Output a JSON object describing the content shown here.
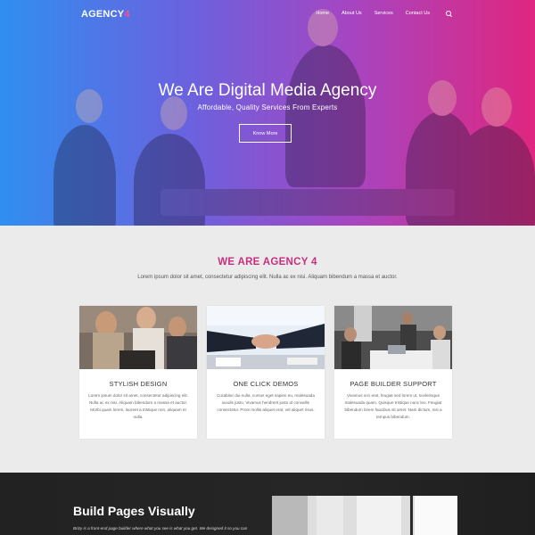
{
  "logo": {
    "text": "AGENCY",
    "accent": "4"
  },
  "nav": {
    "items": [
      "Home",
      "About Us",
      "Services",
      "Contact Us"
    ]
  },
  "hero": {
    "title": "We Are Digital Media Agency",
    "subtitle": "Affordable, Quality Services From Experts",
    "button_label": "Know More"
  },
  "about": {
    "title": "WE ARE AGENCY 4",
    "description": "Lorem ipsum dolor sit amet, consectetur adipiscing elit. Nulla ac ex nisi. Aliquam bibendum a massa et auctor."
  },
  "cards": [
    {
      "title": "STYLISH DESIGN",
      "text": "Lorem ipsum dolor sit amet, consectetur adipiscing elit. Nulla ac ex nisi. Aliquam bibendum a massa et auctor. Morbi quam lorem, laoreet a tristique non, aliquam et nulla."
    },
    {
      "title": "ONE CLICK DEMOS",
      "text": "Curabitur dui nulla, cursus eget sapien eu, malesuada iaculis justo. Vivamus hendrerit justo id convallis consectetur. Proin mollis aliquet erat, vel aliquet risus."
    },
    {
      "title": "PAGE BUILDER SUPPORT",
      "text": "Vivamus orci erat, feugiat sed lorem ut, scelerisque malesuada quam. Quisque tristique nunc leo. Feugiat bibendum lorem faucibus sit amet. Nam dictum, nisi a tempus bibendum."
    }
  ],
  "build": {
    "title": "Build Pages Visually",
    "text": "Brizy is a front-end page builder where what you see is what you get. We designed it so you can"
  },
  "colors": {
    "gradient_start": "#2f8ff0",
    "gradient_end": "#e0267f",
    "accent": "#c72f7d",
    "section_bg": "#ebebeb",
    "dark_bg": "#222222"
  }
}
